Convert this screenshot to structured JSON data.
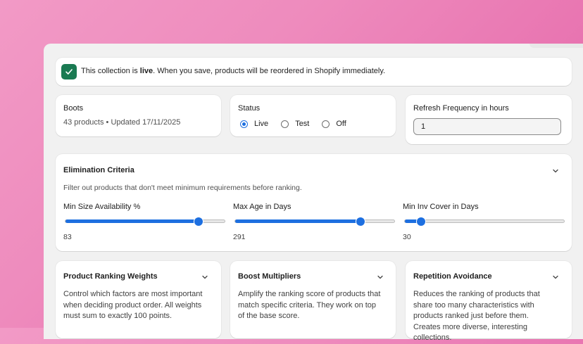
{
  "banner": {
    "prefix": "This collection is ",
    "status_word": "live",
    "suffix": ". When you save, products will be reordered in Shopify immediately."
  },
  "collection": {
    "name": "Boots",
    "meta": "43 products • Updated 17/11/2025"
  },
  "status": {
    "title": "Status",
    "options": [
      {
        "label": "Live",
        "selected": true
      },
      {
        "label": "Test",
        "selected": false
      },
      {
        "label": "Off",
        "selected": false
      }
    ]
  },
  "refresh": {
    "title": "Refresh Frequency in hours",
    "value": "1"
  },
  "elimination": {
    "title": "Elimination Criteria",
    "description": "Filter out products that don't meet minimum requirements before ranking.",
    "sliders": [
      {
        "label": "Min Size Availability %",
        "value": "83",
        "fraction": 0.83
      },
      {
        "label": "Max Age in Days",
        "value": "291",
        "fraction": 0.78
      },
      {
        "label": "Min Inv Cover in Days",
        "value": "30",
        "fraction": 0.1
      }
    ]
  },
  "sections": [
    {
      "title": "Product Ranking Weights",
      "description": "Control which factors are most important when deciding product order. All weights must sum to exactly 100 points."
    },
    {
      "title": "Boost Multipliers",
      "description": "Amplify the ranking score of products that match specific criteria. They work on top of the base score."
    },
    {
      "title": "Repetition Avoidance",
      "description": "Reduces the ranking of products that share too many characteristics with products ranked just before them. Creates more diverse, interesting collections."
    }
  ],
  "colors": {
    "accent": "#1d6fe0",
    "success": "#1a7a52"
  }
}
